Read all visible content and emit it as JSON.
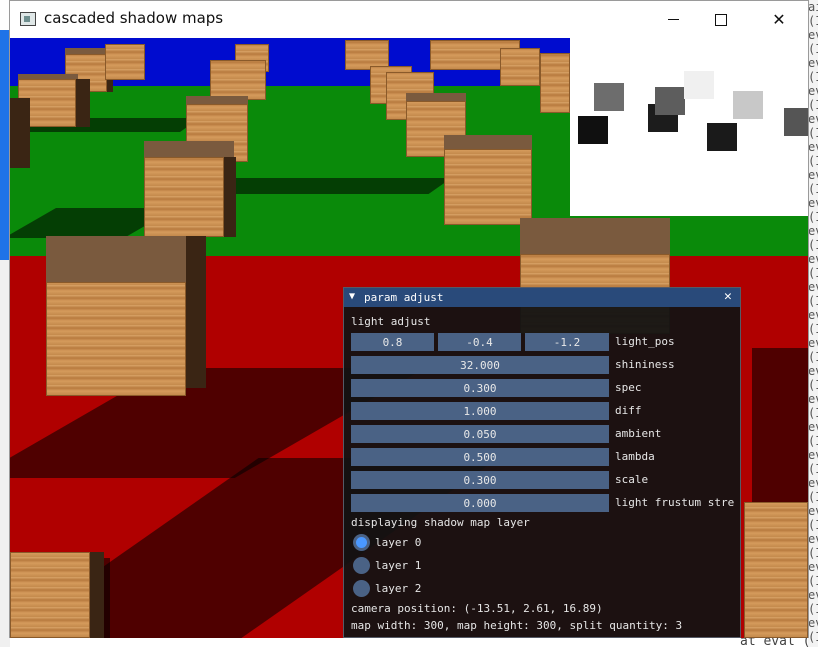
{
  "window": {
    "title": "cascaded shadow maps"
  },
  "panel": {
    "title": "param adjust",
    "section_light": "light adjust",
    "light_pos": {
      "label": "light_pos",
      "x": "0.8",
      "y": "-0.4",
      "z": "-1.2"
    },
    "sliders": [
      {
        "value": "32.000",
        "label": "shininess"
      },
      {
        "value": "0.300",
        "label": "spec"
      },
      {
        "value": "1.000",
        "label": "diff"
      },
      {
        "value": "0.050",
        "label": "ambient"
      },
      {
        "value": "0.500",
        "label": "lambda"
      },
      {
        "value": "0.300",
        "label": "scale"
      },
      {
        "value": "0.000",
        "label": "light frustum stre"
      }
    ],
    "section_layer": "displaying shadow map layer",
    "layers": [
      {
        "label": "layer 0",
        "selected": true
      },
      {
        "label": "layer 1",
        "selected": false
      },
      {
        "label": "layer 2",
        "selected": false
      }
    ],
    "camera_position": "camera position: (-13.51, 2.61, 16.89)",
    "map_info": "map width: 300, map height: 300, split quantity: 3"
  },
  "background": {
    "bottom_code": "at eval (",
    "right_code": [
      "ai",
      "(I",
      "ev",
      "(I",
      "ev",
      "(I",
      "ev",
      "(I",
      "ev",
      "(I",
      "ev",
      "(I",
      "ev",
      "(I",
      "ev",
      "(I",
      "ev",
      "(I",
      "ev",
      "(I",
      "ev",
      "(I",
      "ev",
      "(I",
      "ev",
      "(I",
      "ev",
      "(I",
      "ev",
      "(I",
      "ev",
      "(I",
      "ev",
      "(I",
      "ev",
      "(I",
      "ev",
      "(I",
      "ev",
      "(I",
      "ev",
      "(I",
      "ev",
      "(I",
      "ev",
      "(I"
    ]
  }
}
